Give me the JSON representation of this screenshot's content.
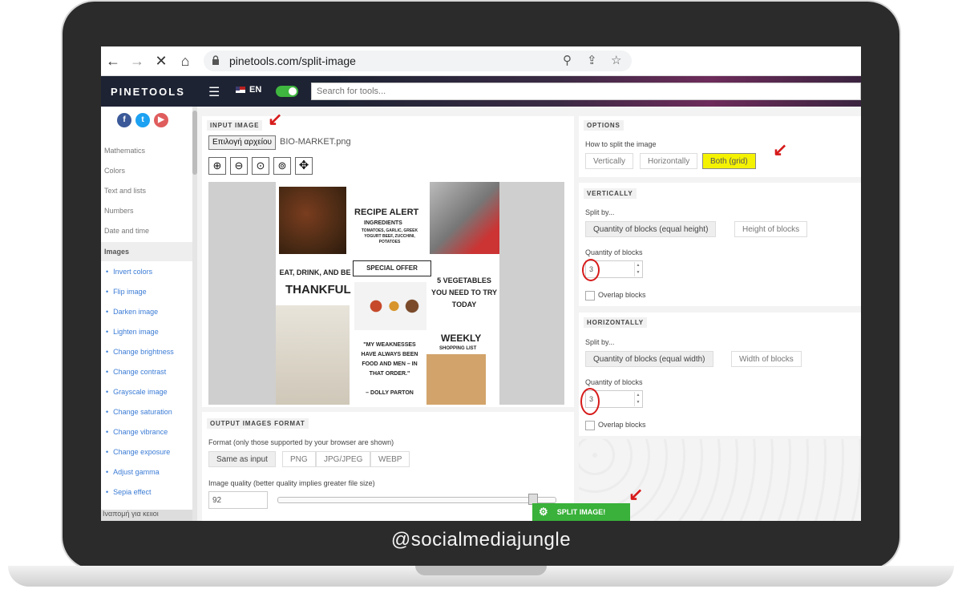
{
  "browser": {
    "url": "pinetools.com/split-image"
  },
  "site": {
    "logo": "PINETOOLS",
    "language": "EN",
    "search_placeholder": "Search for tools..."
  },
  "sidebar": {
    "categories": [
      "Mathematics",
      "Colors",
      "Text and lists",
      "Numbers",
      "Date and time",
      "Images"
    ],
    "image_tools": [
      "Invert colors",
      "Flip image",
      "Darken image",
      "Lighten image",
      "Change brightness",
      "Change contrast",
      "Grayscale image",
      "Change saturation",
      "Change vibrance",
      "Change exposure",
      "Adjust gamma",
      "Sepia effect"
    ],
    "bottom_text": "Ιναπομή για κειιοι"
  },
  "input_image": {
    "title": "INPUT IMAGE",
    "file_button": "Επιλογή αρχείου",
    "file_name": "BIO-MARKET.png"
  },
  "poster": {
    "recipe_alert": "RECIPE ALERT",
    "ingredients": "INGREDIENTS",
    "ingredients_list": "TOMATOES, GARLIC, GREEK YOGURT BEEF, ZUCCHINI, POTATOES",
    "special_offer": "SPECIAL OFFER",
    "eat_drink": "EAT, DRINK, AND BE",
    "thankful": "THANKFUL",
    "vegetables": "5 VEGETABLES YOU NEED TO TRY TODAY",
    "weekly": "WEEKLY",
    "shopping_list": "SHOPPING LIST",
    "quote": "\"MY WEAKNESSES HAVE ALWAYS BEEN FOOD AND MEN – IN THAT ORDER.\"",
    "quote_author": "– DOLLY PARTON"
  },
  "output": {
    "title": "OUTPUT IMAGES FORMAT",
    "format_label": "Format (only those supported by your browser are shown)",
    "formats": [
      "Same as input",
      "PNG",
      "JPG/JPEG",
      "WEBP"
    ],
    "quality_label": "Image quality (better quality implies greater file size)",
    "quality_value": "92",
    "quality_level": 0.92
  },
  "options": {
    "title": "OPTIONS",
    "split_label": "How to split the image",
    "split_modes": [
      "Vertically",
      "Horizontally",
      "Both (grid)"
    ]
  },
  "vertically": {
    "title": "VERTICALLY",
    "split_by_label": "Split by...",
    "modes": [
      "Quantity of blocks (equal height)",
      "Height of blocks"
    ],
    "quantity_label": "Quantity of blocks",
    "quantity_value": "3",
    "overlap_label": "Overlap blocks"
  },
  "horizontally": {
    "title": "HORIZONTALLY",
    "split_by_label": "Split by...",
    "modes": [
      "Quantity of blocks (equal width)",
      "Width of blocks"
    ],
    "quantity_label": "Quantity of blocks",
    "quantity_value": "3",
    "overlap_label": "Overlap blocks"
  },
  "split_button": "SPLIT IMAGE!",
  "watermark": "@socialmediajungle",
  "colors": {
    "accent_green": "#39b13a",
    "highlight_yellow": "#f4f200",
    "annotation_red": "#d71a1a"
  }
}
